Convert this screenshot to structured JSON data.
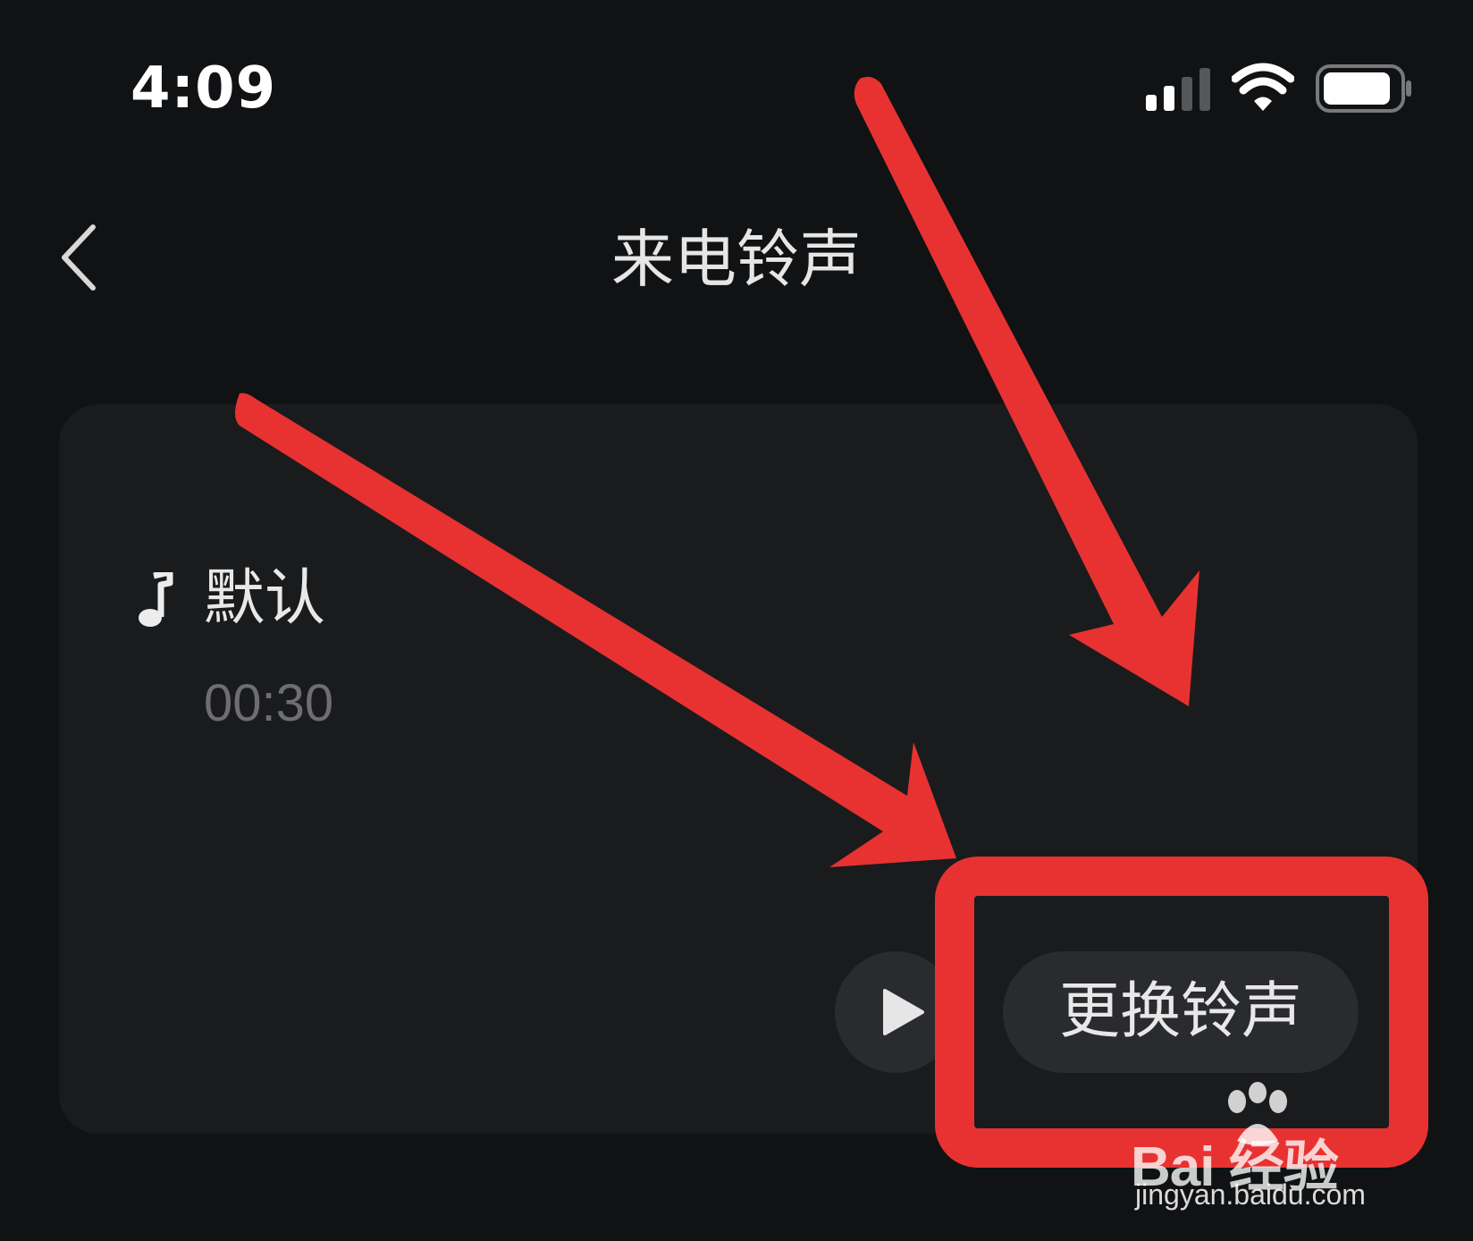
{
  "status_bar": {
    "time": "4:09",
    "icons": [
      "signal-icon",
      "wifi-icon",
      "battery-icon"
    ]
  },
  "header": {
    "back_icon": "chevron-left-icon",
    "title": "来电铃声"
  },
  "ringtone": {
    "icon": "music-note-icon",
    "name": "默认",
    "duration": "00:30",
    "play_icon": "play-icon",
    "change_label": "更换铃声"
  },
  "watermark": {
    "brand": "Bai 经验",
    "url": "jingyan.baidu.com"
  },
  "colors": {
    "background": "#111214",
    "card": "#1a1b1d",
    "button": "#2a2b2e",
    "annotation_red": "#e83232"
  }
}
